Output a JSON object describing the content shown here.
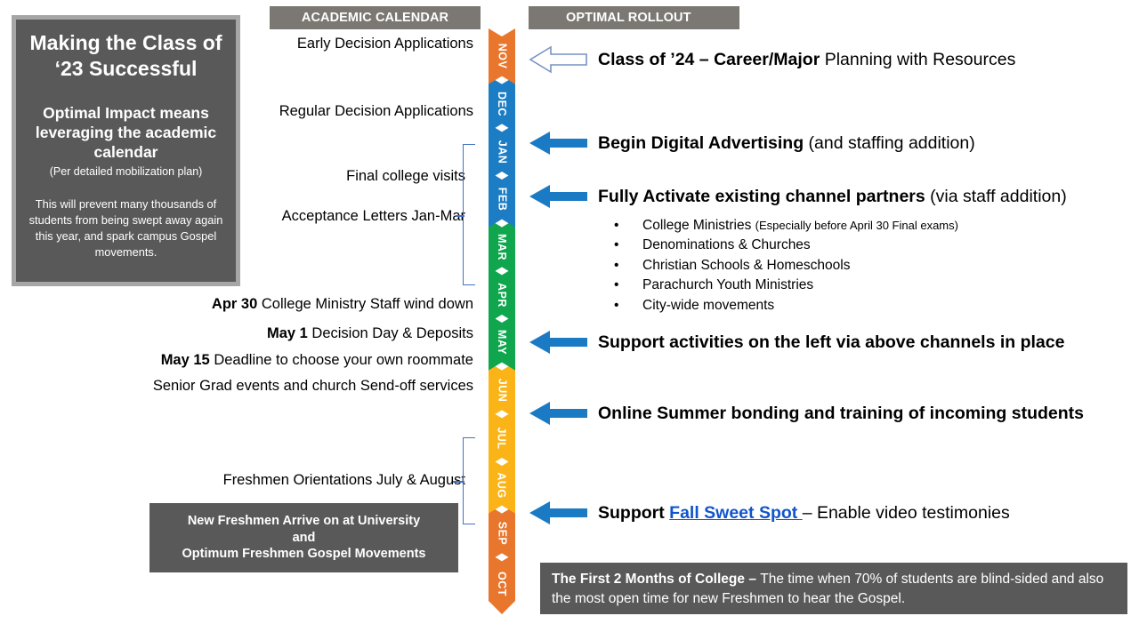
{
  "headers": {
    "academic_calendar": "ACADEMIC CALENDAR",
    "optimal_rollout": "OPTIMAL ROLLOUT"
  },
  "title_card": {
    "heading": "Making the Class of ‘23 Successful",
    "subheading": "Optimal Impact means leveraging the academic calendar",
    "note": "(Per detailed mobilization plan)",
    "body": "This will prevent many thousands of students from being swept away again this year, and spark campus Gospel movements."
  },
  "calendar_items": [
    {
      "lead": "",
      "text": "Early Decision Applications"
    },
    {
      "lead": "",
      "text": "Regular Decision Applications"
    },
    {
      "lead": "",
      "text": "Final college visits"
    },
    {
      "lead": "",
      "text": "Acceptance Letters Jan-Mar"
    },
    {
      "lead": "Apr 30",
      "text": "College Ministry Staff wind down"
    },
    {
      "lead": "May 1",
      "text": "Decision Day & Deposits"
    },
    {
      "lead": "May 15",
      "text": "Deadline to choose your own roommate"
    },
    {
      "lead": "",
      "text": "Senior Grad events and church Send-off services"
    },
    {
      "lead": "",
      "text": "Freshmen Orientations July & August"
    }
  ],
  "freshmen_box": {
    "line1": "New Freshmen Arrive on at University",
    "line2": "and",
    "line3": "Optimum Freshmen Gospel Movements"
  },
  "months": [
    {
      "label": "NOV",
      "color": "#E8762C"
    },
    {
      "label": "DEC",
      "color": "#1D7DC4"
    },
    {
      "label": "JAN",
      "color": "#1D7DC4"
    },
    {
      "label": "FEB",
      "color": "#1D7DC4"
    },
    {
      "label": "MAR",
      "color": "#0FA64E"
    },
    {
      "label": "APR",
      "color": "#0FA64E"
    },
    {
      "label": "MAY",
      "color": "#0FA64E"
    },
    {
      "label": "JUN",
      "color": "#FBB418"
    },
    {
      "label": "JUL",
      "color": "#FBB418"
    },
    {
      "label": "AUG",
      "color": "#FBB418"
    },
    {
      "label": "SEP",
      "color": "#E8762C"
    },
    {
      "label": "OCT",
      "color": "#E8762C"
    }
  ],
  "rollout_rows": [
    {
      "arrow": "hollow-left-arrow",
      "segments": [
        {
          "text": "Class of ’24 – Career/Major",
          "style": "strong"
        },
        {
          "text": " Planning with Resources",
          "style": "normal"
        }
      ]
    },
    {
      "arrow": "solid-left-arrow",
      "segments": [
        {
          "text": "Begin Digital Advertising",
          "style": "strong"
        },
        {
          "text": " (and staffing addition)",
          "style": "normal"
        }
      ]
    },
    {
      "arrow": "solid-left-arrow",
      "segments": [
        {
          "text": "Fully Activate existing channel partners",
          "style": "strong"
        },
        {
          "text": " (via staff addition)",
          "style": "normal"
        }
      ]
    },
    {
      "arrow": "solid-left-arrow",
      "segments": [
        {
          "text": "Support activities on the left via above channels in place",
          "style": "strong"
        }
      ]
    },
    {
      "arrow": "solid-left-arrow",
      "segments": [
        {
          "text": "Online Summer bonding and training of incoming students",
          "style": "strong"
        }
      ]
    },
    {
      "arrow": "solid-left-arrow",
      "segments": [
        {
          "text": "Support ",
          "style": "strong"
        },
        {
          "text": "Fall Sweet Spot ",
          "style": "link"
        },
        {
          "text": "– Enable video testimonies",
          "style": "normal"
        }
      ]
    }
  ],
  "channel_bullets": [
    {
      "text": "College Ministries ",
      "note": "(Especially before April 30 Final exams)"
    },
    {
      "text": "Denominations & Churches",
      "note": ""
    },
    {
      "text": "Christian Schools & Homeschools",
      "note": ""
    },
    {
      "text": "Parachurch Youth Ministries",
      "note": ""
    },
    {
      "text": "City-wide movements",
      "note": ""
    }
  ],
  "bottom_banner": {
    "strong": "The First 2 Months of College – ",
    "text": "The time when 70% of students are blind-sided and also the most open time for new Freshmen to hear the Gospel."
  },
  "colors": {
    "dark_gray": "#595959",
    "header_gray": "#7B7772",
    "border_gray": "#A6A6A6",
    "arrow_blue": "#1B7AC4",
    "bracket_blue": "#4472C4",
    "link_blue": "#1155CC"
  }
}
